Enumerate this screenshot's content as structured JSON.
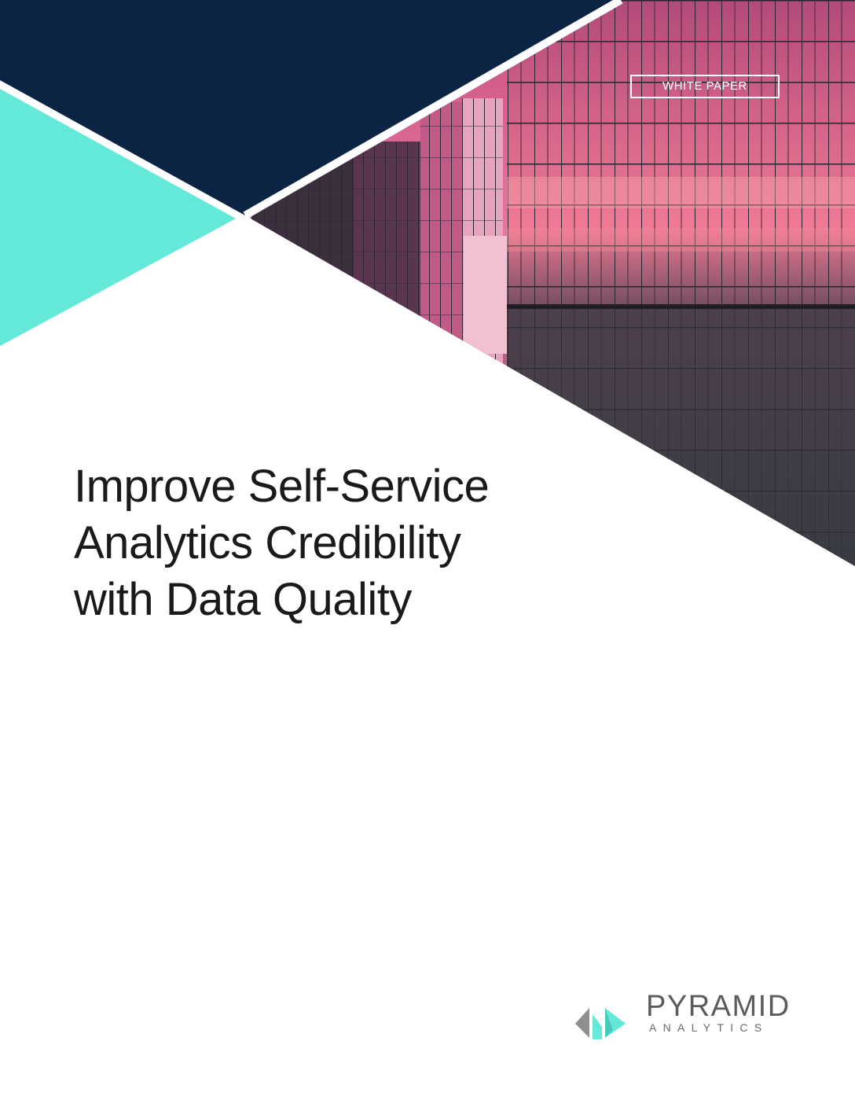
{
  "badge": {
    "label": "WHITE PAPER"
  },
  "title": {
    "lines": [
      "Improve Self-Service",
      "Analytics Credibility",
      "with Data Quality"
    ]
  },
  "logo": {
    "name": "PYRAMID",
    "sub": "ANALYTICS"
  },
  "colors": {
    "navy": "#0c2444",
    "teal": "#64e8d8",
    "pink": "#e56a95",
    "logo_gray": "#5c5c5c"
  }
}
